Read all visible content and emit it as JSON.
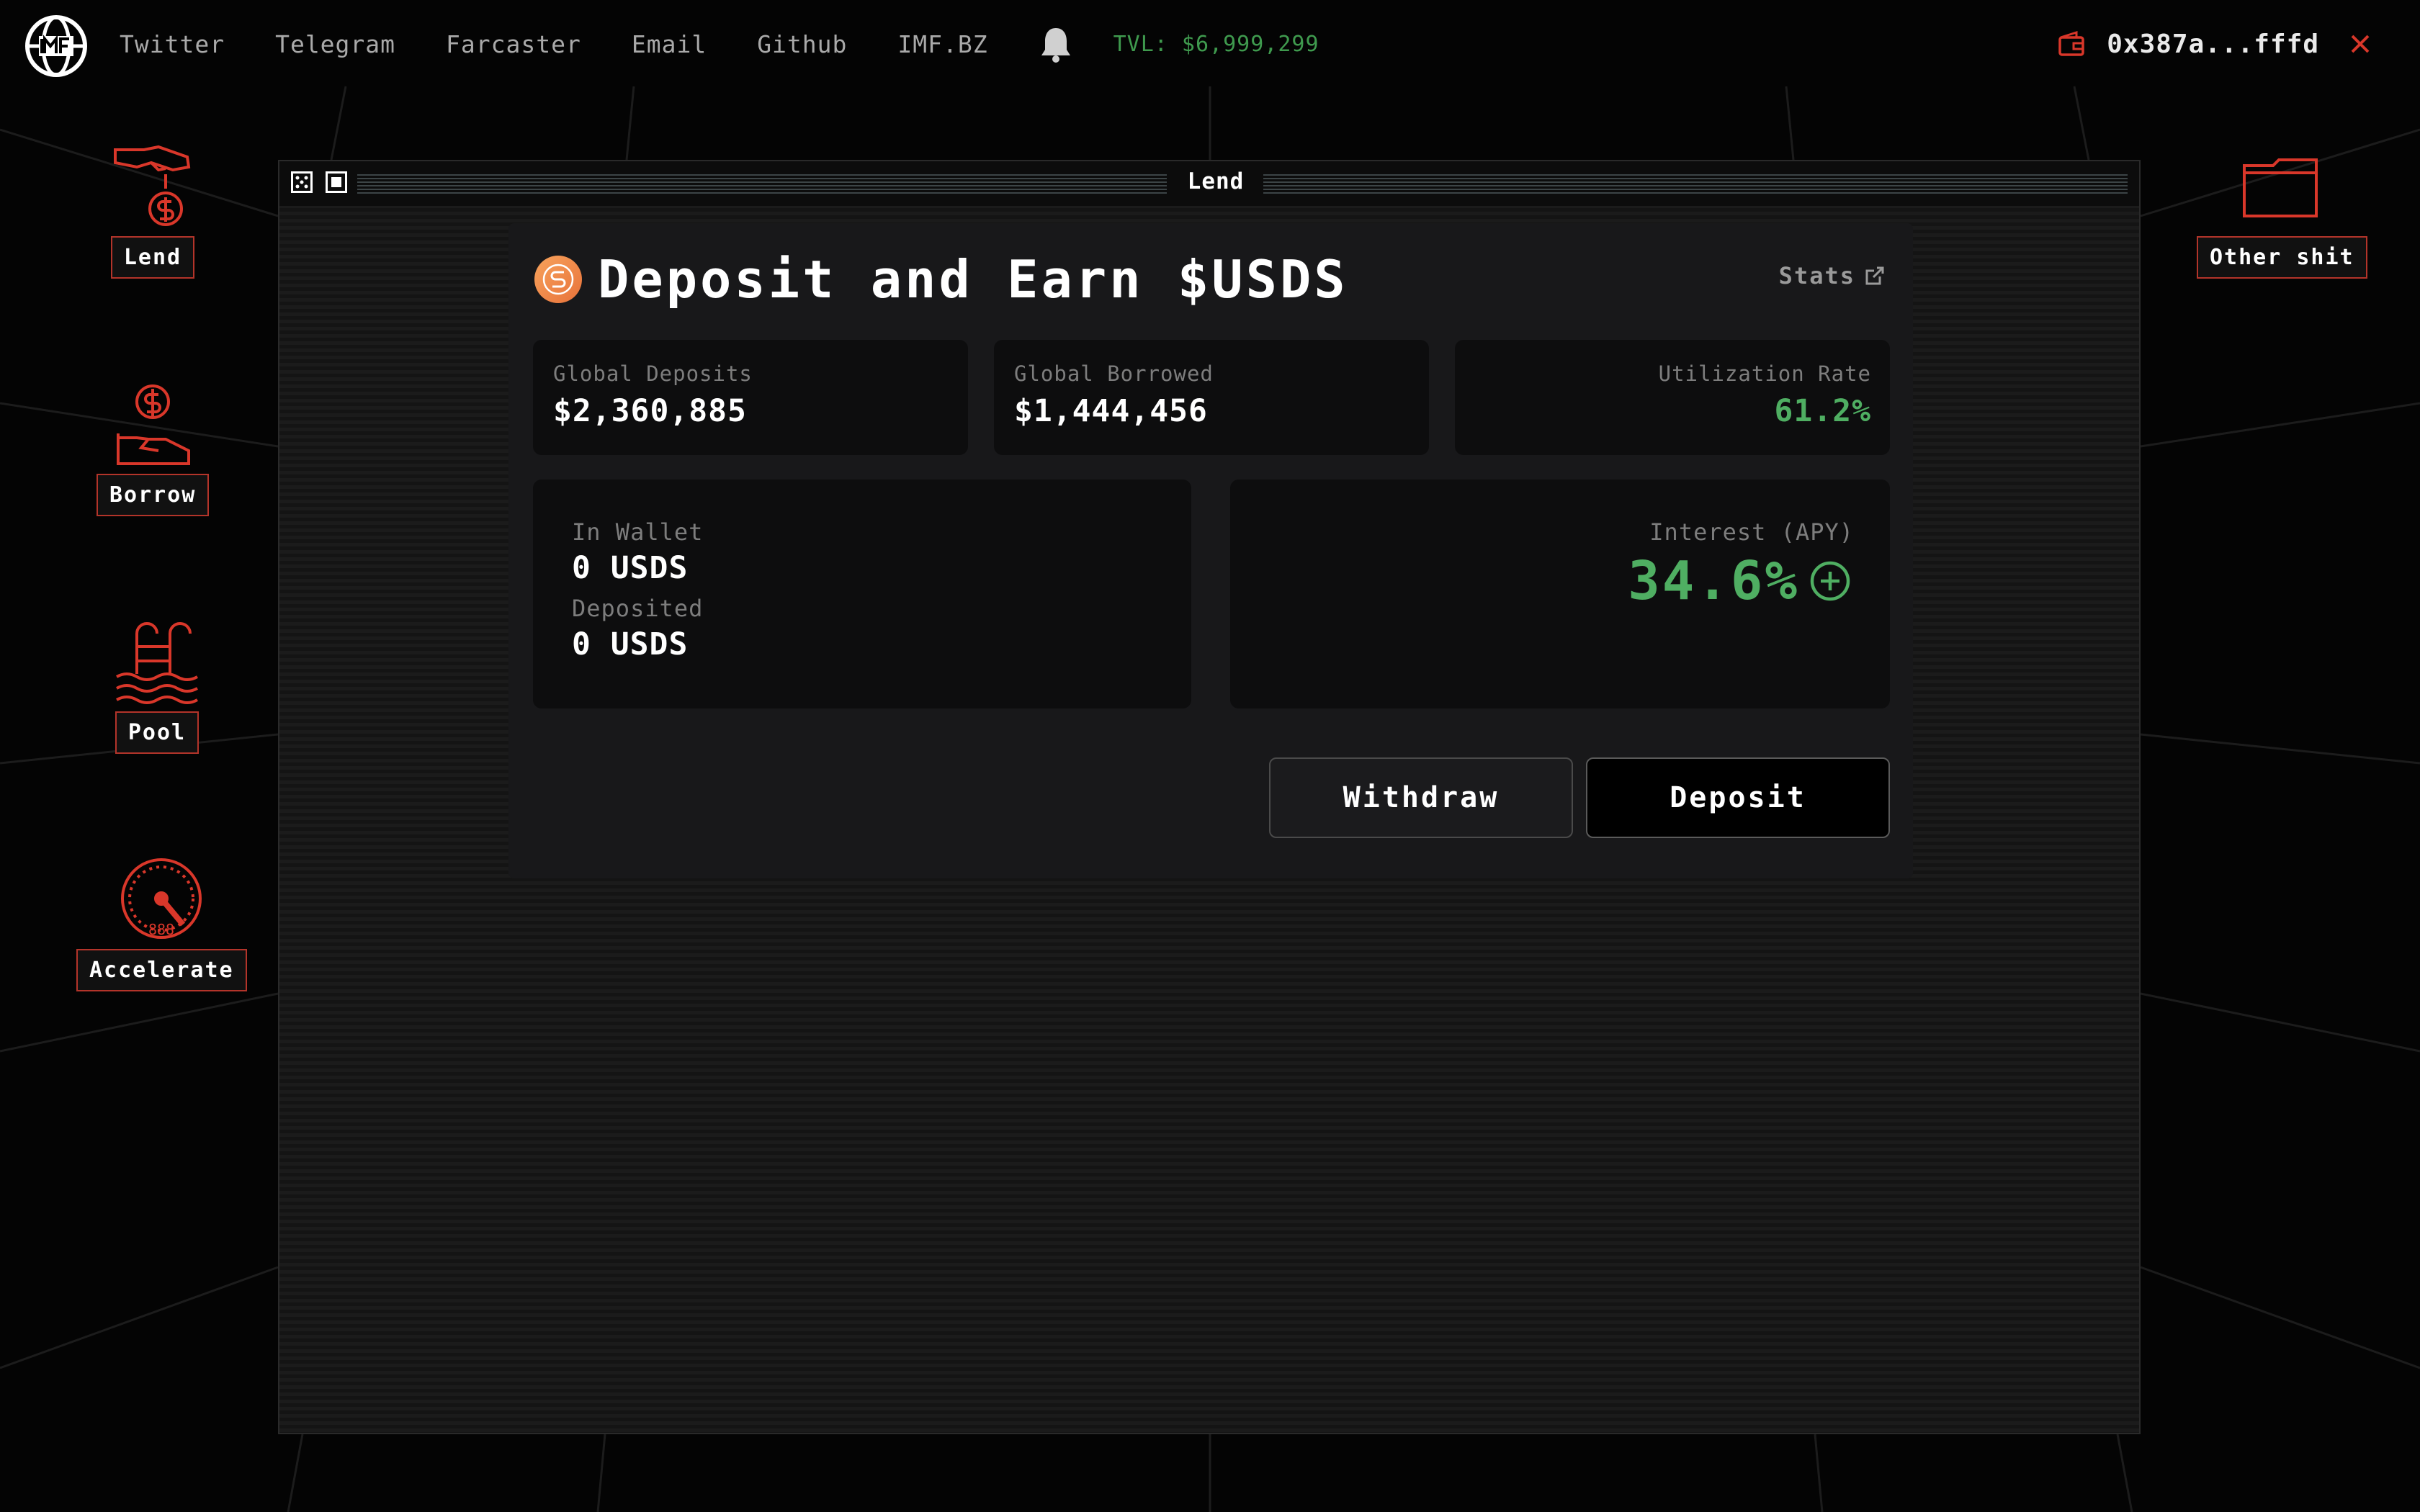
{
  "nav": {
    "links": [
      "Twitter",
      "Telegram",
      "Farcaster",
      "Email",
      "Github",
      "IMF.BZ"
    ],
    "tvl": "TVL: $6,999,299"
  },
  "wallet": {
    "address": "0x387a...fffd"
  },
  "desktop": {
    "lend": "Lend",
    "borrow": "Borrow",
    "pool": "Pool",
    "accelerate": "Accelerate",
    "other": "Other shit"
  },
  "window": {
    "title": "Lend"
  },
  "card": {
    "title": "Deposit and Earn $USDS",
    "stats_link": "Stats",
    "global_deposits_label": "Global Deposits",
    "global_deposits": "$2,360,885",
    "global_borrowed_label": "Global Borrowed",
    "global_borrowed": "$1,444,456",
    "utilization_label": "Utilization Rate",
    "utilization": "61.2%",
    "in_wallet_label": "In Wallet",
    "in_wallet": "0 USDS",
    "deposited_label": "Deposited",
    "deposited": "0 USDS",
    "interest_label": "Interest (APY)",
    "interest": "34.6%",
    "withdraw": "Withdraw",
    "deposit": "Deposit"
  },
  "colors": {
    "accent_red": "#d9372a",
    "green": "#4fae62",
    "background": "#040404"
  }
}
